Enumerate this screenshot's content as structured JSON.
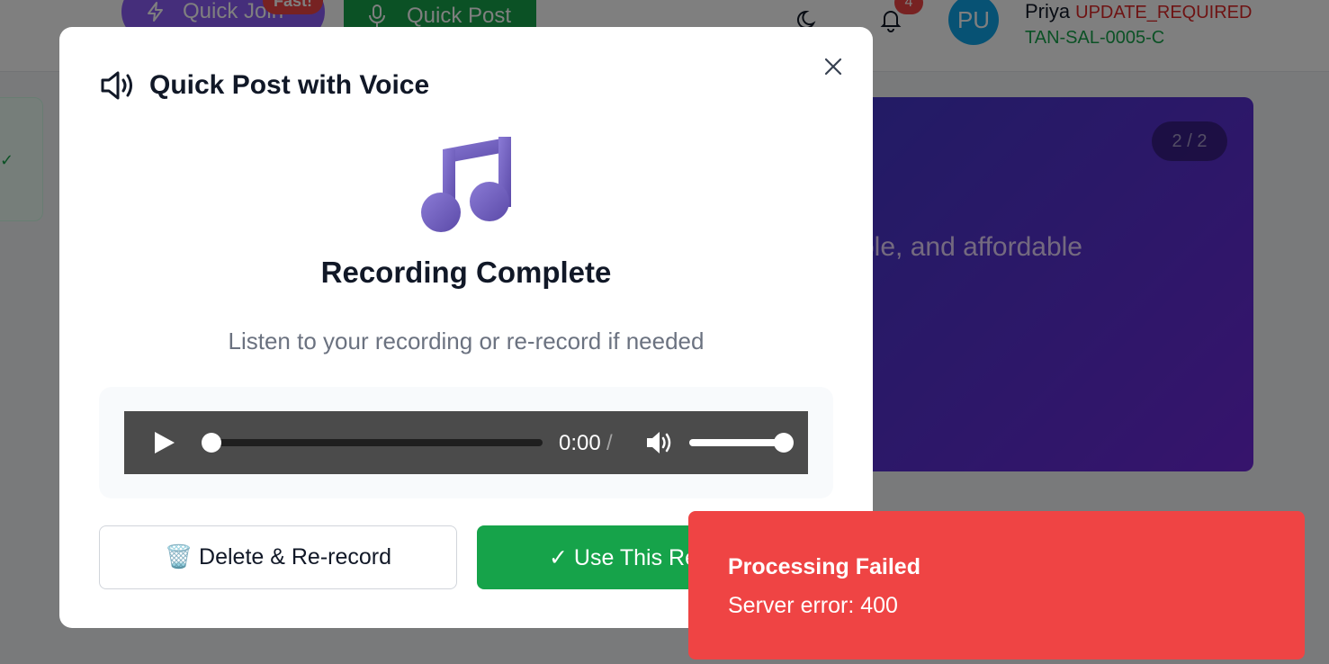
{
  "topbar": {
    "quick_join_label": "Quick Join",
    "fast_badge": "Fast!",
    "quick_post_label": "Quick Post",
    "notification_count": "4",
    "avatar_initials": "PU",
    "user_name": "Priya",
    "user_status": "UPDATE_REQUIRED",
    "user_code": "TAN-SAL-0005-C"
  },
  "hero": {
    "counter": "2 / 2",
    "text": "ble, and affordable"
  },
  "modal": {
    "title": "Quick Post with Voice",
    "recording_title": "Recording Complete",
    "recording_subtitle": "Listen to your recording or re-record if needed",
    "audio": {
      "current_time": "0:00",
      "separator": "/",
      "progress": 0,
      "volume": 1.0
    },
    "delete_button": "🗑️ Delete & Re-record",
    "use_button": "✓ Use This Recording"
  },
  "toast": {
    "title": "Processing Failed",
    "message": "Server error: 400"
  },
  "colors": {
    "success": "#16a34a",
    "error": "#ef4444",
    "purple": "#8b5cf6"
  }
}
